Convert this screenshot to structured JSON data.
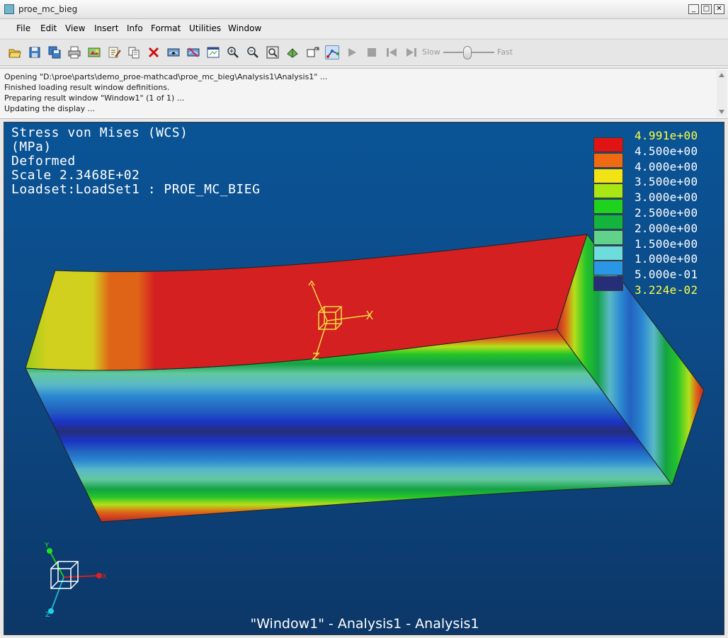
{
  "window": {
    "title": "proe_mc_bieg"
  },
  "menu": [
    "File",
    "Edit",
    "View",
    "Insert",
    "Info",
    "Format",
    "Utilities",
    "Window"
  ],
  "toolbar": {
    "icons": [
      "open-icon",
      "save-icon",
      "save-all-icon",
      "print-icon",
      "copy-image-icon",
      "edit-definition-icon",
      "copy-icon",
      "delete-icon",
      "show-icon",
      "hide-icon",
      "new-window-icon",
      "zoom-in-icon",
      "zoom-out-icon",
      "refit-icon",
      "orient-icon",
      "spin-icon",
      "view-toggle-icon",
      "play-icon",
      "stop-icon",
      "step-back-icon",
      "step-forward-icon"
    ],
    "slider_slow": "Slow",
    "slider_fast": "Fast"
  },
  "messages": [
    "Opening \"D:\\proe\\parts\\demo_proe-mathcad\\proe_mc_bieg\\Analysis1\\Analysis1\" ...",
    "Finished loading result window definitions.",
    "Preparing result window \"Window1\" (1 of 1) ...",
    "Updating the display ..."
  ],
  "viewport": {
    "info_lines": [
      "Stress von Mises (WCS)",
      "(MPa)",
      "Deformed",
      "Scale  2.3468E+02",
      "Loadset:LoadSet1 :  PROE_MC_BIEG"
    ],
    "caption": "\"Window1\" - Analysis1 - Analysis1",
    "legend": [
      {
        "label": "4.991e+00",
        "color": "#e01414",
        "accent": true
      },
      {
        "label": "4.500e+00",
        "color": "#f06a14",
        "accent": false
      },
      {
        "label": "4.000e+00",
        "color": "#f2e414",
        "accent": false
      },
      {
        "label": "3.500e+00",
        "color": "#a8e614",
        "accent": false
      },
      {
        "label": "3.000e+00",
        "color": "#1ed21e",
        "accent": false
      },
      {
        "label": "2.500e+00",
        "color": "#12b43c",
        "accent": false
      },
      {
        "label": "2.000e+00",
        "color": "#60d28a",
        "accent": false
      },
      {
        "label": "1.500e+00",
        "color": "#6edcdc",
        "accent": false
      },
      {
        "label": "1.000e+00",
        "color": "#2a96e6",
        "accent": false
      },
      {
        "label": "5.000e-01",
        "color": "#0a24e0",
        "accent": false
      },
      {
        "label": "3.224e-02",
        "color": null,
        "accent": true
      }
    ],
    "legend_bottom_color": "#262e78",
    "axis_labels": {
      "x": "X",
      "y": "Y",
      "z": "Z"
    }
  }
}
